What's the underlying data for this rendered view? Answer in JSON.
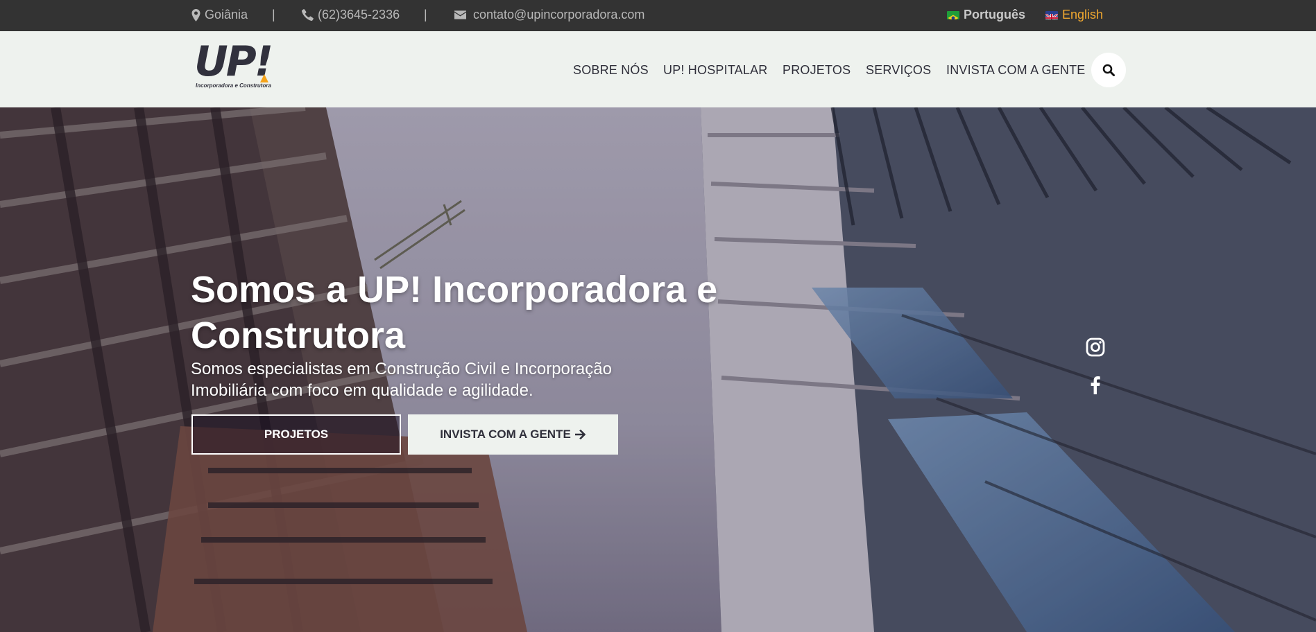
{
  "topbar": {
    "city": "Goiânia",
    "phone": "(62)3645-2336",
    "email": "contato@upincorporadora.com",
    "separator": "|",
    "languages": [
      {
        "label": "Português",
        "color": "#c9c9c9"
      },
      {
        "label": "English",
        "color": "#f0a830"
      }
    ]
  },
  "logo": {
    "mark": "UP!",
    "tagline": "Incorporadora e Construtora",
    "accent": "#f5a31a"
  },
  "nav": {
    "items": [
      "SOBRE NÓS",
      "UP! HOSPITALAR",
      "PROJETOS",
      "SERVIÇOS",
      "INVISTA COM A GENTE"
    ],
    "search_icon": "search-icon"
  },
  "hero": {
    "title": "Somos a UP! Incorporadora e Construtora",
    "subtitle": "Somos especialistas em Construção Civil e Incorporação Imobiliária com foco em qualidade e agilidade.",
    "primary_button": "PROJETOS",
    "secondary_button": "INVISTA COM A GENTE",
    "social": [
      "instagram-icon",
      "facebook-icon"
    ]
  },
  "colors": {
    "topbar_bg": "#333333",
    "header_bg": "#eef2ee",
    "text_dark": "#2f2f3a"
  }
}
